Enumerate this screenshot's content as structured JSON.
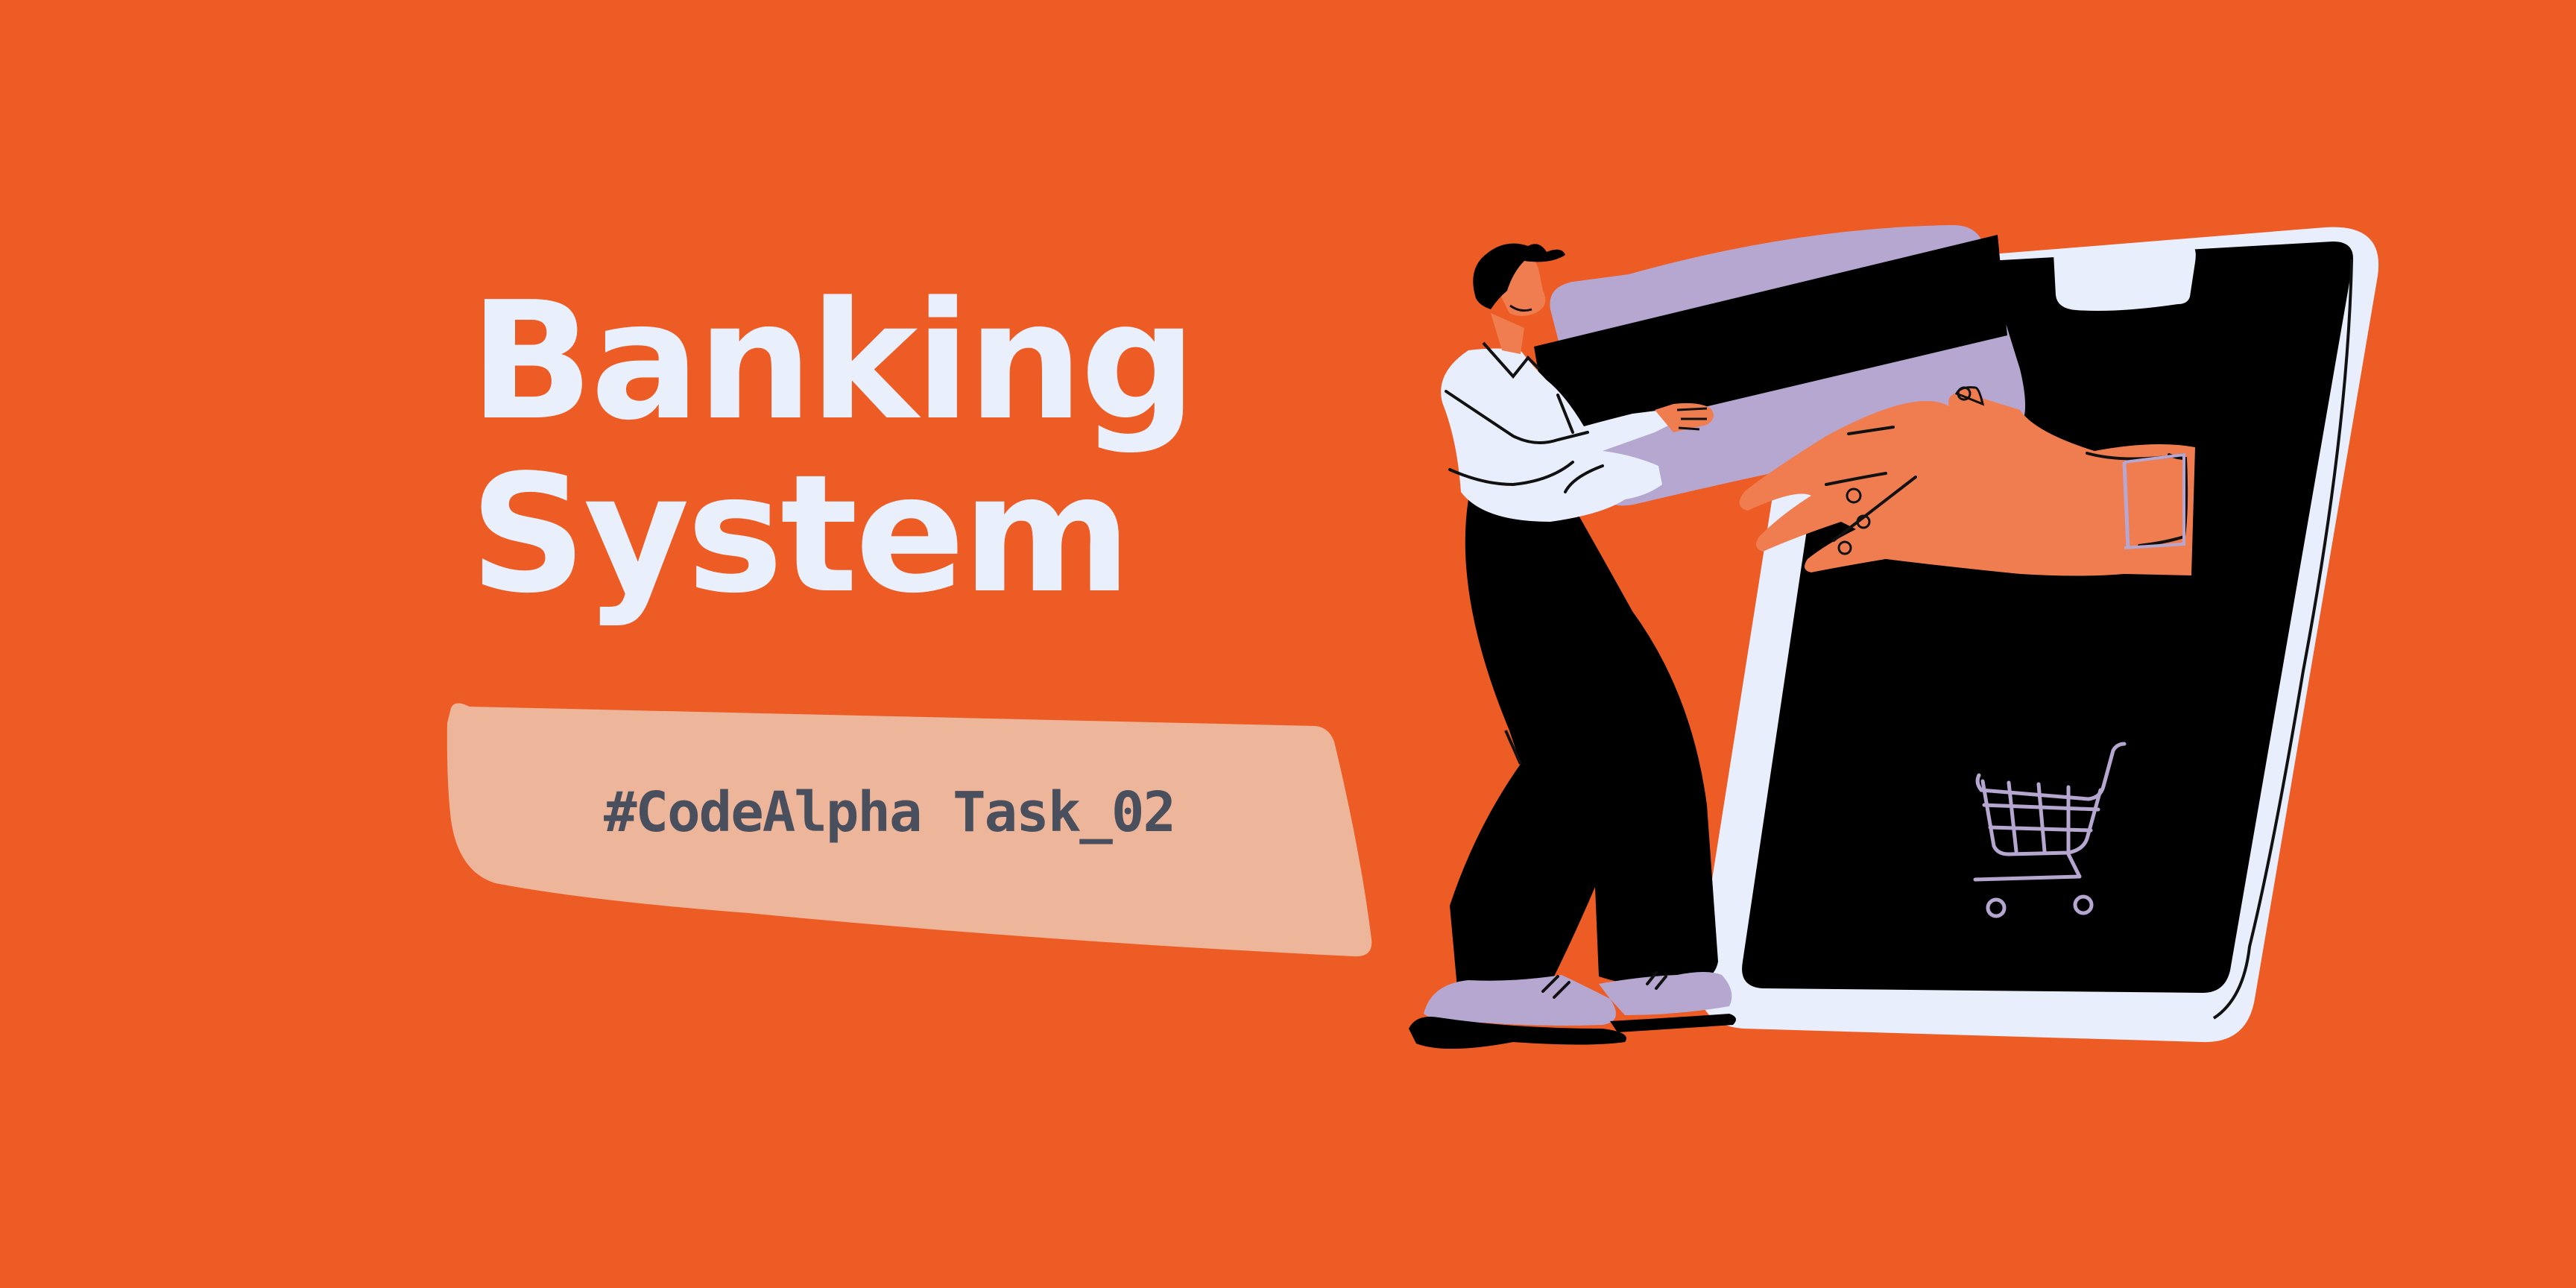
{
  "banner": {
    "title_line1": "Banking",
    "title_line2": "System",
    "tag": "#CodeAlpha Task_02"
  },
  "colors": {
    "background": "#ec5c24",
    "title": "#eaf0fb",
    "tag_fill": "#edb59a",
    "tag_text": "#4a4f5e",
    "card": "#b6a7d1",
    "phone_frame": "#e8eefb",
    "phone_screen": "#000000",
    "skin": "#f07d50"
  },
  "illustration": {
    "subject": "person-with-card-and-phone",
    "icons": [
      "credit-card-icon",
      "smartphone-icon",
      "shopping-cart-icon",
      "hand-icon"
    ]
  }
}
